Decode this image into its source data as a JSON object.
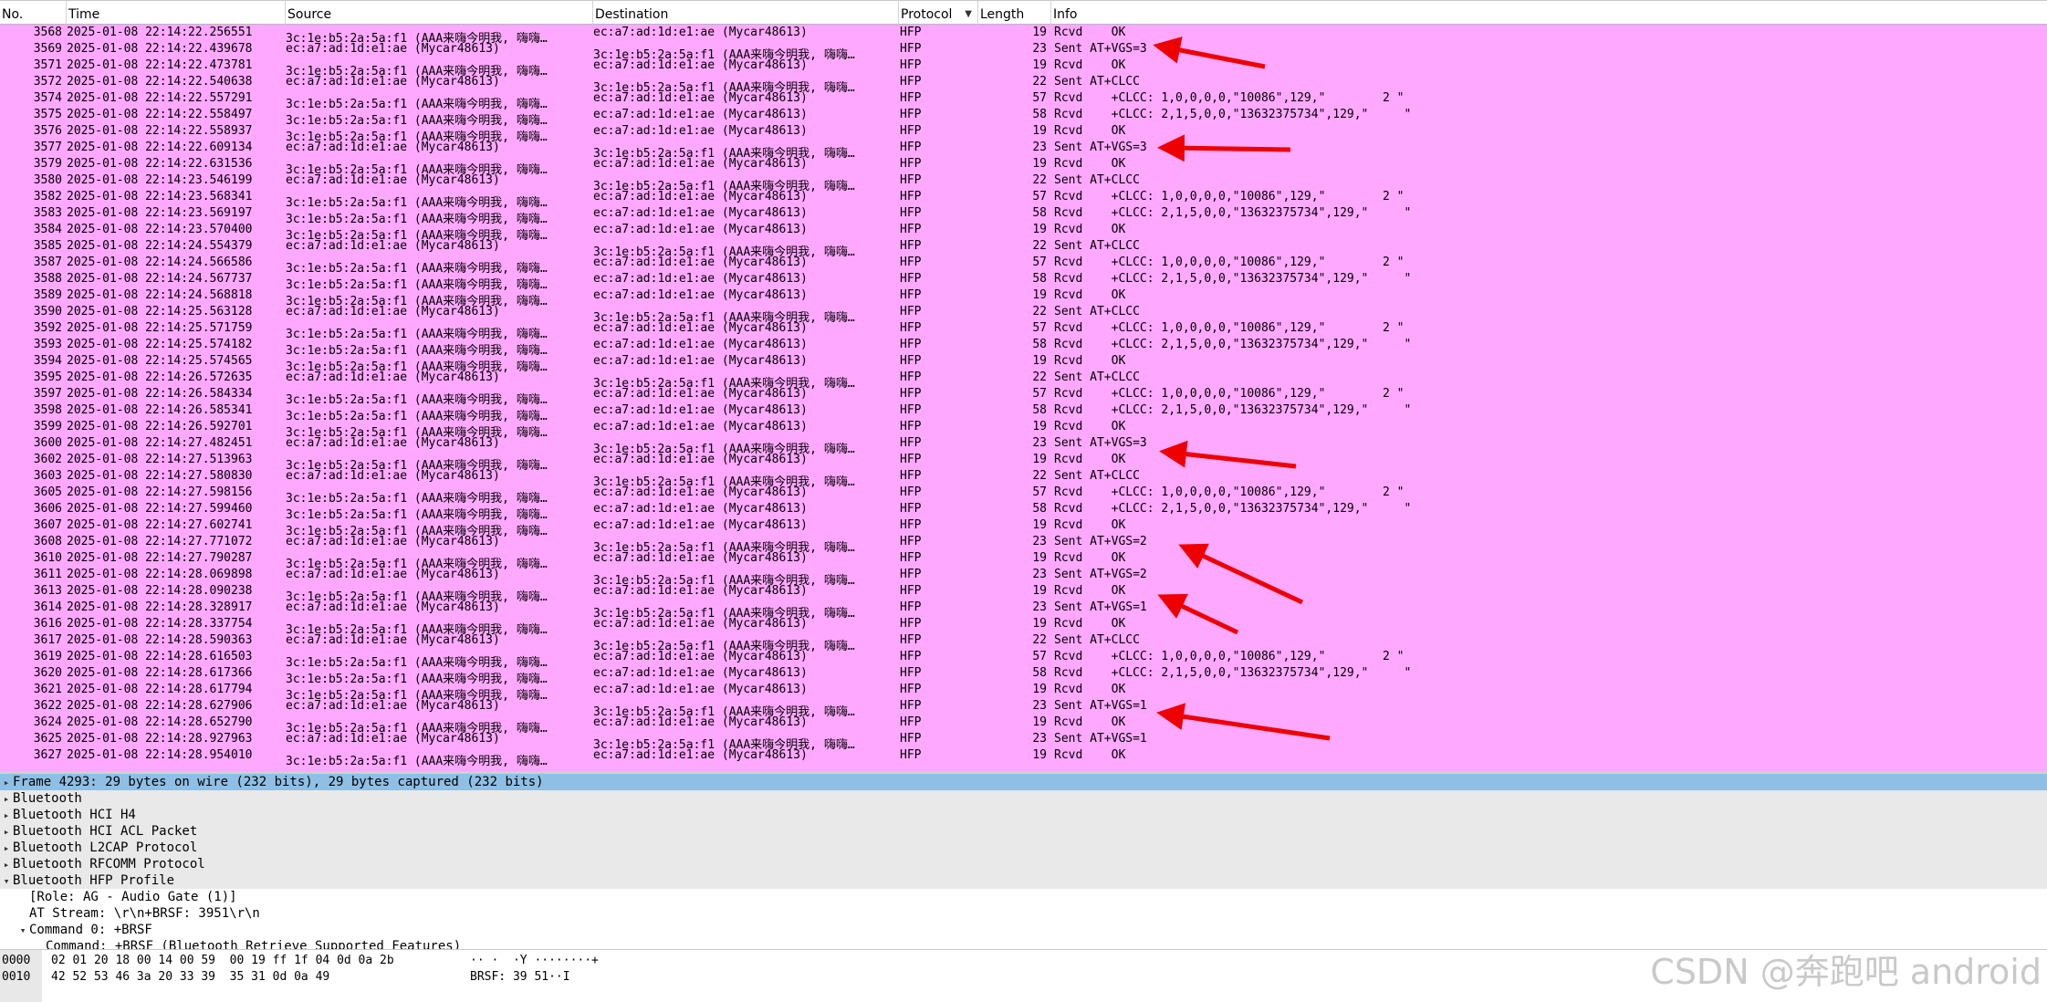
{
  "columns": {
    "no": "No.",
    "time": "Time",
    "source": "Source",
    "destination": "Destination",
    "protocol": "Protocol",
    "length": "Length",
    "info": "Info"
  },
  "watermark": "CSDN @奔跑吧 android",
  "packets": [
    {
      "no": "3568",
      "time": "2025-01-08 22:14:22.256551",
      "src": "3c:1e:b5:2a:5a:f1 (AAA来嗨今明我, 嗨嗨…",
      "dst": "ec:a7:ad:1d:e1:ae (Mycar48613)",
      "proto": "HFP",
      "len": "19",
      "info": "Rcvd    OK",
      "dir": "in"
    },
    {
      "no": "3569",
      "time": "2025-01-08 22:14:22.439678",
      "src": "ec:a7:ad:1d:e1:ae (Mycar48613)",
      "dst": "3c:1e:b5:2a:5a:f1 (AAA来嗨今明我, 嗨嗨…",
      "proto": "HFP",
      "len": "23",
      "info": "Sent AT+VGS=3",
      "dir": "out"
    },
    {
      "no": "3571",
      "time": "2025-01-08 22:14:22.473781",
      "src": "3c:1e:b5:2a:5a:f1 (AAA来嗨今明我, 嗨嗨…",
      "dst": "ec:a7:ad:1d:e1:ae (Mycar48613)",
      "proto": "HFP",
      "len": "19",
      "info": "Rcvd    OK",
      "dir": "in"
    },
    {
      "no": "3572",
      "time": "2025-01-08 22:14:22.540638",
      "src": "ec:a7:ad:1d:e1:ae (Mycar48613)",
      "dst": "3c:1e:b5:2a:5a:f1 (AAA来嗨今明我, 嗨嗨…",
      "proto": "HFP",
      "len": "22",
      "info": "Sent AT+CLCC",
      "dir": "out"
    },
    {
      "no": "3574",
      "time": "2025-01-08 22:14:22.557291",
      "src": "3c:1e:b5:2a:5a:f1 (AAA来嗨今明我, 嗨嗨…",
      "dst": "ec:a7:ad:1d:e1:ae (Mycar48613)",
      "proto": "HFP",
      "len": "57",
      "info": "Rcvd    +CLCC: 1,0,0,0,0,\"10086\",129,\"        2 \"",
      "dir": "in"
    },
    {
      "no": "3575",
      "time": "2025-01-08 22:14:22.558497",
      "src": "3c:1e:b5:2a:5a:f1 (AAA来嗨今明我, 嗨嗨…",
      "dst": "ec:a7:ad:1d:e1:ae (Mycar48613)",
      "proto": "HFP",
      "len": "58",
      "info": "Rcvd    +CLCC: 2,1,5,0,0,\"13632375734\",129,\"     \"",
      "dir": "in"
    },
    {
      "no": "3576",
      "time": "2025-01-08 22:14:22.558937",
      "src": "3c:1e:b5:2a:5a:f1 (AAA来嗨今明我, 嗨嗨…",
      "dst": "ec:a7:ad:1d:e1:ae (Mycar48613)",
      "proto": "HFP",
      "len": "19",
      "info": "Rcvd    OK",
      "dir": "in"
    },
    {
      "no": "3577",
      "time": "2025-01-08 22:14:22.609134",
      "src": "ec:a7:ad:1d:e1:ae (Mycar48613)",
      "dst": "3c:1e:b5:2a:5a:f1 (AAA来嗨今明我, 嗨嗨…",
      "proto": "HFP",
      "len": "23",
      "info": "Sent AT+VGS=3",
      "dir": "out"
    },
    {
      "no": "3579",
      "time": "2025-01-08 22:14:22.631536",
      "src": "3c:1e:b5:2a:5a:f1 (AAA来嗨今明我, 嗨嗨…",
      "dst": "ec:a7:ad:1d:e1:ae (Mycar48613)",
      "proto": "HFP",
      "len": "19",
      "info": "Rcvd    OK",
      "dir": "in"
    },
    {
      "no": "3580",
      "time": "2025-01-08 22:14:23.546199",
      "src": "ec:a7:ad:1d:e1:ae (Mycar48613)",
      "dst": "3c:1e:b5:2a:5a:f1 (AAA来嗨今明我, 嗨嗨…",
      "proto": "HFP",
      "len": "22",
      "info": "Sent AT+CLCC",
      "dir": "out"
    },
    {
      "no": "3582",
      "time": "2025-01-08 22:14:23.568341",
      "src": "3c:1e:b5:2a:5a:f1 (AAA来嗨今明我, 嗨嗨…",
      "dst": "ec:a7:ad:1d:e1:ae (Mycar48613)",
      "proto": "HFP",
      "len": "57",
      "info": "Rcvd    +CLCC: 1,0,0,0,0,\"10086\",129,\"        2 \"",
      "dir": "in"
    },
    {
      "no": "3583",
      "time": "2025-01-08 22:14:23.569197",
      "src": "3c:1e:b5:2a:5a:f1 (AAA来嗨今明我, 嗨嗨…",
      "dst": "ec:a7:ad:1d:e1:ae (Mycar48613)",
      "proto": "HFP",
      "len": "58",
      "info": "Rcvd    +CLCC: 2,1,5,0,0,\"13632375734\",129,\"     \"",
      "dir": "in"
    },
    {
      "no": "3584",
      "time": "2025-01-08 22:14:23.570400",
      "src": "3c:1e:b5:2a:5a:f1 (AAA来嗨今明我, 嗨嗨…",
      "dst": "ec:a7:ad:1d:e1:ae (Mycar48613)",
      "proto": "HFP",
      "len": "19",
      "info": "Rcvd    OK",
      "dir": "in"
    },
    {
      "no": "3585",
      "time": "2025-01-08 22:14:24.554379",
      "src": "ec:a7:ad:1d:e1:ae (Mycar48613)",
      "dst": "3c:1e:b5:2a:5a:f1 (AAA来嗨今明我, 嗨嗨…",
      "proto": "HFP",
      "len": "22",
      "info": "Sent AT+CLCC",
      "dir": "out"
    },
    {
      "no": "3587",
      "time": "2025-01-08 22:14:24.566586",
      "src": "3c:1e:b5:2a:5a:f1 (AAA来嗨今明我, 嗨嗨…",
      "dst": "ec:a7:ad:1d:e1:ae (Mycar48613)",
      "proto": "HFP",
      "len": "57",
      "info": "Rcvd    +CLCC: 1,0,0,0,0,\"10086\",129,\"        2 \"",
      "dir": "in"
    },
    {
      "no": "3588",
      "time": "2025-01-08 22:14:24.567737",
      "src": "3c:1e:b5:2a:5a:f1 (AAA来嗨今明我, 嗨嗨…",
      "dst": "ec:a7:ad:1d:e1:ae (Mycar48613)",
      "proto": "HFP",
      "len": "58",
      "info": "Rcvd    +CLCC: 2,1,5,0,0,\"13632375734\",129,\"     \"",
      "dir": "in"
    },
    {
      "no": "3589",
      "time": "2025-01-08 22:14:24.568818",
      "src": "3c:1e:b5:2a:5a:f1 (AAA来嗨今明我, 嗨嗨…",
      "dst": "ec:a7:ad:1d:e1:ae (Mycar48613)",
      "proto": "HFP",
      "len": "19",
      "info": "Rcvd    OK",
      "dir": "in"
    },
    {
      "no": "3590",
      "time": "2025-01-08 22:14:25.563128",
      "src": "ec:a7:ad:1d:e1:ae (Mycar48613)",
      "dst": "3c:1e:b5:2a:5a:f1 (AAA来嗨今明我, 嗨嗨…",
      "proto": "HFP",
      "len": "22",
      "info": "Sent AT+CLCC",
      "dir": "out"
    },
    {
      "no": "3592",
      "time": "2025-01-08 22:14:25.571759",
      "src": "3c:1e:b5:2a:5a:f1 (AAA来嗨今明我, 嗨嗨…",
      "dst": "ec:a7:ad:1d:e1:ae (Mycar48613)",
      "proto": "HFP",
      "len": "57",
      "info": "Rcvd    +CLCC: 1,0,0,0,0,\"10086\",129,\"        2 \"",
      "dir": "in"
    },
    {
      "no": "3593",
      "time": "2025-01-08 22:14:25.574182",
      "src": "3c:1e:b5:2a:5a:f1 (AAA来嗨今明我, 嗨嗨…",
      "dst": "ec:a7:ad:1d:e1:ae (Mycar48613)",
      "proto": "HFP",
      "len": "58",
      "info": "Rcvd    +CLCC: 2,1,5,0,0,\"13632375734\",129,\"     \"",
      "dir": "in"
    },
    {
      "no": "3594",
      "time": "2025-01-08 22:14:25.574565",
      "src": "3c:1e:b5:2a:5a:f1 (AAA来嗨今明我, 嗨嗨…",
      "dst": "ec:a7:ad:1d:e1:ae (Mycar48613)",
      "proto": "HFP",
      "len": "19",
      "info": "Rcvd    OK",
      "dir": "in"
    },
    {
      "no": "3595",
      "time": "2025-01-08 22:14:26.572635",
      "src": "ec:a7:ad:1d:e1:ae (Mycar48613)",
      "dst": "3c:1e:b5:2a:5a:f1 (AAA来嗨今明我, 嗨嗨…",
      "proto": "HFP",
      "len": "22",
      "info": "Sent AT+CLCC",
      "dir": "out"
    },
    {
      "no": "3597",
      "time": "2025-01-08 22:14:26.584334",
      "src": "3c:1e:b5:2a:5a:f1 (AAA来嗨今明我, 嗨嗨…",
      "dst": "ec:a7:ad:1d:e1:ae (Mycar48613)",
      "proto": "HFP",
      "len": "57",
      "info": "Rcvd    +CLCC: 1,0,0,0,0,\"10086\",129,\"        2 \"",
      "dir": "in"
    },
    {
      "no": "3598",
      "time": "2025-01-08 22:14:26.585341",
      "src": "3c:1e:b5:2a:5a:f1 (AAA来嗨今明我, 嗨嗨…",
      "dst": "ec:a7:ad:1d:e1:ae (Mycar48613)",
      "proto": "HFP",
      "len": "58",
      "info": "Rcvd    +CLCC: 2,1,5,0,0,\"13632375734\",129,\"     \"",
      "dir": "in"
    },
    {
      "no": "3599",
      "time": "2025-01-08 22:14:26.592701",
      "src": "3c:1e:b5:2a:5a:f1 (AAA来嗨今明我, 嗨嗨…",
      "dst": "ec:a7:ad:1d:e1:ae (Mycar48613)",
      "proto": "HFP",
      "len": "19",
      "info": "Rcvd    OK",
      "dir": "in"
    },
    {
      "no": "3600",
      "time": "2025-01-08 22:14:27.482451",
      "src": "ec:a7:ad:1d:e1:ae (Mycar48613)",
      "dst": "3c:1e:b5:2a:5a:f1 (AAA来嗨今明我, 嗨嗨…",
      "proto": "HFP",
      "len": "23",
      "info": "Sent AT+VGS=3",
      "dir": "out"
    },
    {
      "no": "3602",
      "time": "2025-01-08 22:14:27.513963",
      "src": "3c:1e:b5:2a:5a:f1 (AAA来嗨今明我, 嗨嗨…",
      "dst": "ec:a7:ad:1d:e1:ae (Mycar48613)",
      "proto": "HFP",
      "len": "19",
      "info": "Rcvd    OK",
      "dir": "in"
    },
    {
      "no": "3603",
      "time": "2025-01-08 22:14:27.580830",
      "src": "ec:a7:ad:1d:e1:ae (Mycar48613)",
      "dst": "3c:1e:b5:2a:5a:f1 (AAA来嗨今明我, 嗨嗨…",
      "proto": "HFP",
      "len": "22",
      "info": "Sent AT+CLCC",
      "dir": "out"
    },
    {
      "no": "3605",
      "time": "2025-01-08 22:14:27.598156",
      "src": "3c:1e:b5:2a:5a:f1 (AAA来嗨今明我, 嗨嗨…",
      "dst": "ec:a7:ad:1d:e1:ae (Mycar48613)",
      "proto": "HFP",
      "len": "57",
      "info": "Rcvd    +CLCC: 1,0,0,0,0,\"10086\",129,\"        2 \"",
      "dir": "in"
    },
    {
      "no": "3606",
      "time": "2025-01-08 22:14:27.599460",
      "src": "3c:1e:b5:2a:5a:f1 (AAA来嗨今明我, 嗨嗨…",
      "dst": "ec:a7:ad:1d:e1:ae (Mycar48613)",
      "proto": "HFP",
      "len": "58",
      "info": "Rcvd    +CLCC: 2,1,5,0,0,\"13632375734\",129,\"     \"",
      "dir": "in"
    },
    {
      "no": "3607",
      "time": "2025-01-08 22:14:27.602741",
      "src": "3c:1e:b5:2a:5a:f1 (AAA来嗨今明我, 嗨嗨…",
      "dst": "ec:a7:ad:1d:e1:ae (Mycar48613)",
      "proto": "HFP",
      "len": "19",
      "info": "Rcvd    OK",
      "dir": "in"
    },
    {
      "no": "3608",
      "time": "2025-01-08 22:14:27.771072",
      "src": "ec:a7:ad:1d:e1:ae (Mycar48613)",
      "dst": "3c:1e:b5:2a:5a:f1 (AAA来嗨今明我, 嗨嗨…",
      "proto": "HFP",
      "len": "23",
      "info": "Sent AT+VGS=2",
      "dir": "out"
    },
    {
      "no": "3610",
      "time": "2025-01-08 22:14:27.790287",
      "src": "3c:1e:b5:2a:5a:f1 (AAA来嗨今明我, 嗨嗨…",
      "dst": "ec:a7:ad:1d:e1:ae (Mycar48613)",
      "proto": "HFP",
      "len": "19",
      "info": "Rcvd    OK",
      "dir": "in"
    },
    {
      "no": "3611",
      "time": "2025-01-08 22:14:28.069898",
      "src": "ec:a7:ad:1d:e1:ae (Mycar48613)",
      "dst": "3c:1e:b5:2a:5a:f1 (AAA来嗨今明我, 嗨嗨…",
      "proto": "HFP",
      "len": "23",
      "info": "Sent AT+VGS=2",
      "dir": "out"
    },
    {
      "no": "3613",
      "time": "2025-01-08 22:14:28.090238",
      "src": "3c:1e:b5:2a:5a:f1 (AAA来嗨今明我, 嗨嗨…",
      "dst": "ec:a7:ad:1d:e1:ae (Mycar48613)",
      "proto": "HFP",
      "len": "19",
      "info": "Rcvd    OK",
      "dir": "in"
    },
    {
      "no": "3614",
      "time": "2025-01-08 22:14:28.328917",
      "src": "ec:a7:ad:1d:e1:ae (Mycar48613)",
      "dst": "3c:1e:b5:2a:5a:f1 (AAA来嗨今明我, 嗨嗨…",
      "proto": "HFP",
      "len": "23",
      "info": "Sent AT+VGS=1",
      "dir": "out"
    },
    {
      "no": "3616",
      "time": "2025-01-08 22:14:28.337754",
      "src": "3c:1e:b5:2a:5a:f1 (AAA来嗨今明我, 嗨嗨…",
      "dst": "ec:a7:ad:1d:e1:ae (Mycar48613)",
      "proto": "HFP",
      "len": "19",
      "info": "Rcvd    OK",
      "dir": "in"
    },
    {
      "no": "3617",
      "time": "2025-01-08 22:14:28.590363",
      "src": "ec:a7:ad:1d:e1:ae (Mycar48613)",
      "dst": "3c:1e:b5:2a:5a:f1 (AAA来嗨今明我, 嗨嗨…",
      "proto": "HFP",
      "len": "22",
      "info": "Sent AT+CLCC",
      "dir": "out"
    },
    {
      "no": "3619",
      "time": "2025-01-08 22:14:28.616503",
      "src": "3c:1e:b5:2a:5a:f1 (AAA来嗨今明我, 嗨嗨…",
      "dst": "ec:a7:ad:1d:e1:ae (Mycar48613)",
      "proto": "HFP",
      "len": "57",
      "info": "Rcvd    +CLCC: 1,0,0,0,0,\"10086\",129,\"        2 \"",
      "dir": "in"
    },
    {
      "no": "3620",
      "time": "2025-01-08 22:14:28.617366",
      "src": "3c:1e:b5:2a:5a:f1 (AAA来嗨今明我, 嗨嗨…",
      "dst": "ec:a7:ad:1d:e1:ae (Mycar48613)",
      "proto": "HFP",
      "len": "58",
      "info": "Rcvd    +CLCC: 2,1,5,0,0,\"13632375734\",129,\"     \"",
      "dir": "in"
    },
    {
      "no": "3621",
      "time": "2025-01-08 22:14:28.617794",
      "src": "3c:1e:b5:2a:5a:f1 (AAA来嗨今明我, 嗨嗨…",
      "dst": "ec:a7:ad:1d:e1:ae (Mycar48613)",
      "proto": "HFP",
      "len": "19",
      "info": "Rcvd    OK",
      "dir": "in"
    },
    {
      "no": "3622",
      "time": "2025-01-08 22:14:28.627906",
      "src": "ec:a7:ad:1d:e1:ae (Mycar48613)",
      "dst": "3c:1e:b5:2a:5a:f1 (AAA来嗨今明我, 嗨嗨…",
      "proto": "HFP",
      "len": "23",
      "info": "Sent AT+VGS=1",
      "dir": "out"
    },
    {
      "no": "3624",
      "time": "2025-01-08 22:14:28.652790",
      "src": "3c:1e:b5:2a:5a:f1 (AAA来嗨今明我, 嗨嗨…",
      "dst": "ec:a7:ad:1d:e1:ae (Mycar48613)",
      "proto": "HFP",
      "len": "19",
      "info": "Rcvd    OK",
      "dir": "in"
    },
    {
      "no": "3625",
      "time": "2025-01-08 22:14:28.927963",
      "src": "ec:a7:ad:1d:e1:ae (Mycar48613)",
      "dst": "3c:1e:b5:2a:5a:f1 (AAA来嗨今明我, 嗨嗨…",
      "proto": "HFP",
      "len": "23",
      "info": "Sent AT+VGS=1",
      "dir": "out"
    },
    {
      "no": "3627",
      "time": "2025-01-08 22:14:28.954010",
      "src": "3c:1e:b5:2a:5a:f1 (AAA来嗨今明我, 嗨嗨…",
      "dst": "ec:a7:ad:1d:e1:ae (Mycar48613)",
      "proto": "HFP",
      "len": "19",
      "info": "Rcvd    OK",
      "dir": "in"
    }
  ],
  "details": [
    {
      "text": "Frame 4293: 29 bytes on wire (232 bits), 29 bytes captured (232 bits)",
      "tri": "▸",
      "selected": true,
      "indent": 0
    },
    {
      "text": "Bluetooth",
      "tri": "▸",
      "selected": false,
      "indent": 0
    },
    {
      "text": "Bluetooth HCI H4",
      "tri": "▸",
      "selected": false,
      "indent": 0
    },
    {
      "text": "Bluetooth HCI ACL Packet",
      "tri": "▸",
      "selected": false,
      "indent": 0
    },
    {
      "text": "Bluetooth L2CAP Protocol",
      "tri": "▸",
      "selected": false,
      "indent": 0
    },
    {
      "text": "Bluetooth RFCOMM Protocol",
      "tri": "▸",
      "selected": false,
      "indent": 0
    },
    {
      "text": "Bluetooth HFP Profile",
      "tri": "▾",
      "selected": false,
      "indent": 0
    },
    {
      "text": "[Role: AG - Audio Gate (1)]",
      "tri": "",
      "selected": false,
      "indent": 1
    },
    {
      "text": "AT Stream: \\r\\n+BRSF: 3951\\r\\n",
      "tri": "",
      "selected": false,
      "indent": 1
    },
    {
      "text": "Command 0: +BRSF",
      "tri": "▾",
      "selected": false,
      "indent": 1
    },
    {
      "text": "Command: +BRSF (Bluetooth Retrieve Supported Features)",
      "tri": "",
      "selected": false,
      "indent": 2
    }
  ],
  "hex": [
    {
      "offset": "0000",
      "bytes": "02 01 20 18 00 14 00 59  00 19 ff 1f 04 0d 0a 2b",
      "ascii": "·· ·  ·Y ········+"
    },
    {
      "offset": "0010",
      "bytes": "42 52 53 46 3a 20 33 39  35 31 0d 0a 49",
      "ascii": "BRSF: 39 51··I"
    }
  ],
  "annotations": {
    "arrow_color": "#ee0000",
    "arrow_rows": [
      "3569",
      "3577",
      "3600",
      "3608",
      "3614",
      "3622"
    ]
  }
}
